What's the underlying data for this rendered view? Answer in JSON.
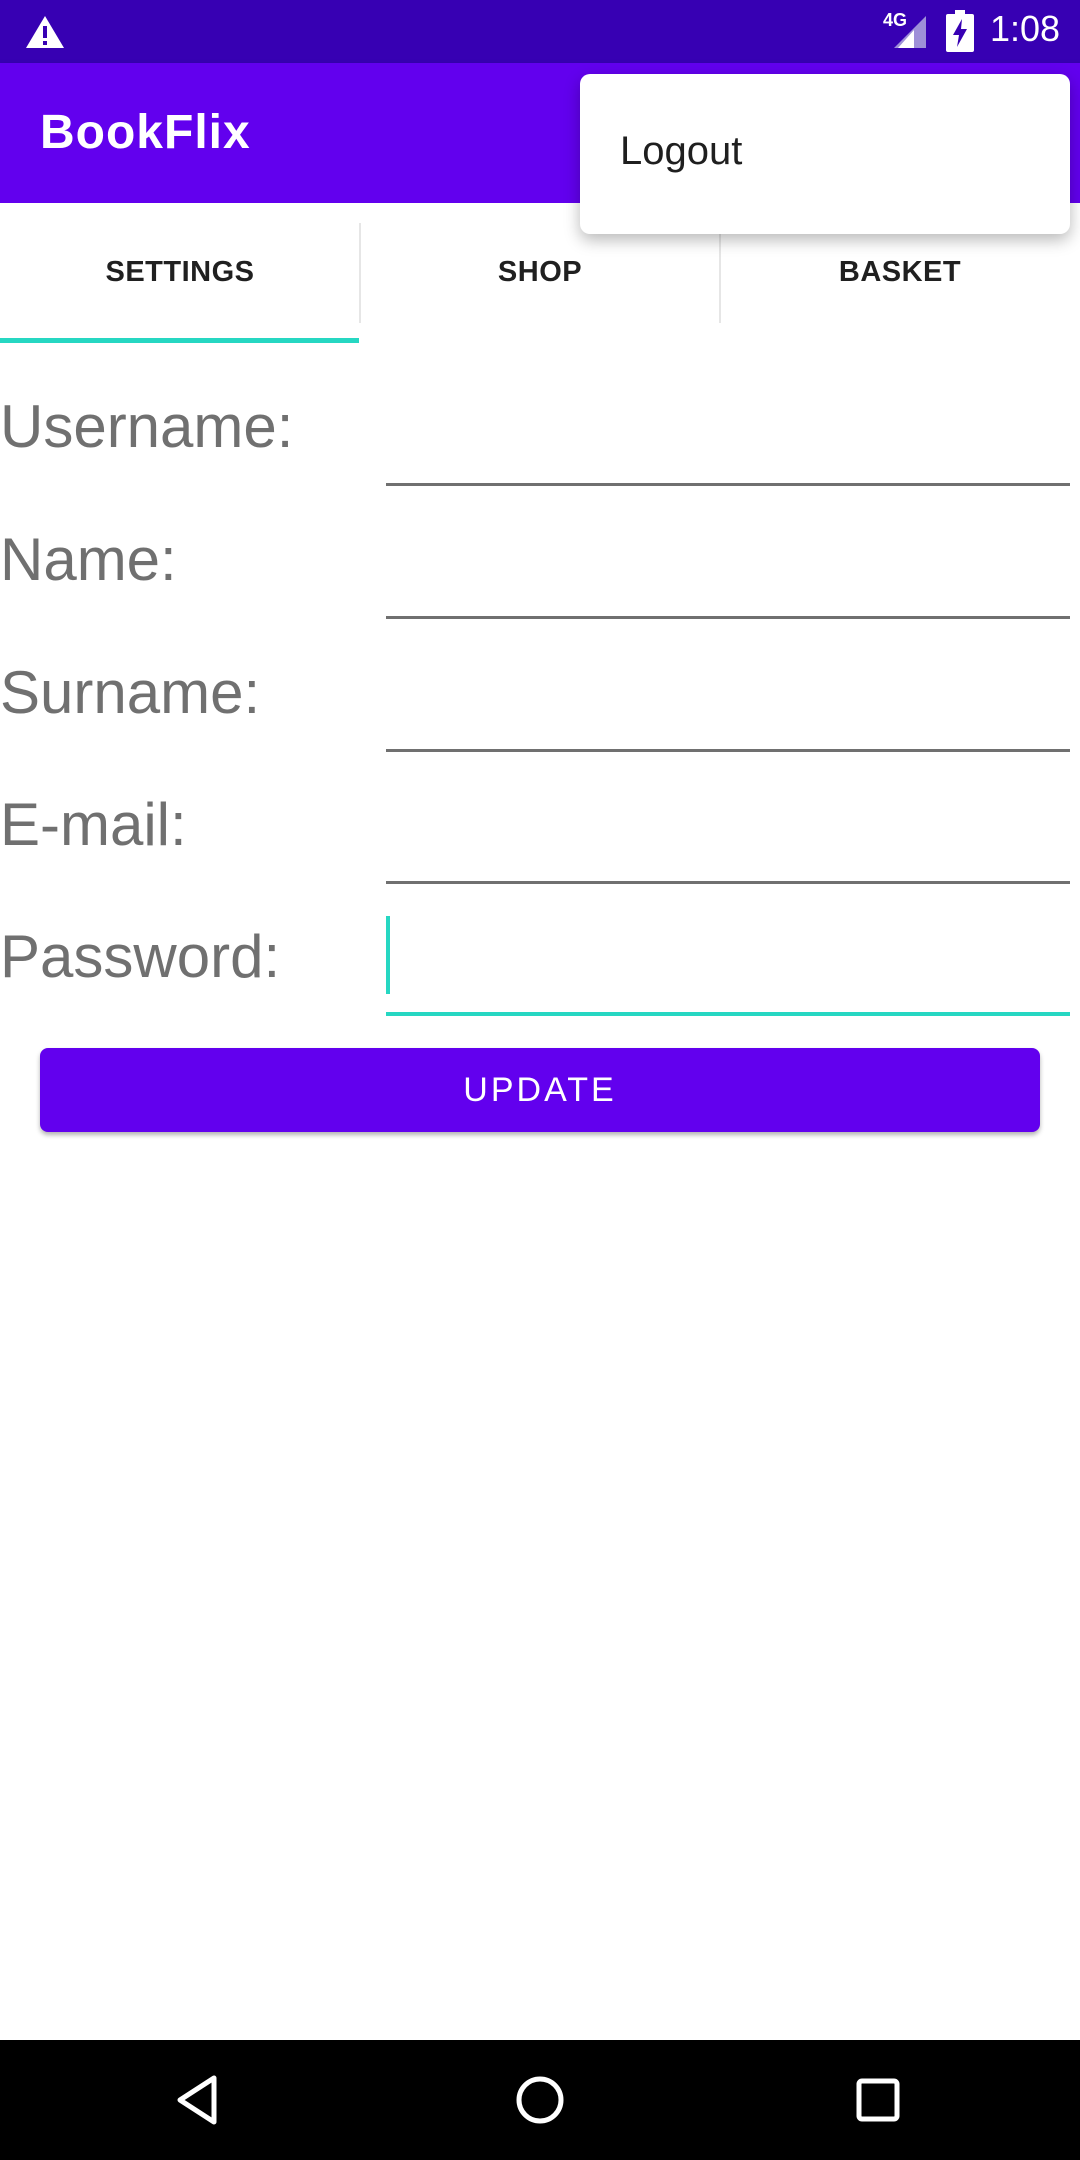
{
  "status_bar": {
    "network": "4G",
    "time": "1:08",
    "icons": [
      "warning-icon",
      "signal-icon",
      "battery-charging-icon"
    ]
  },
  "app_bar": {
    "title": "BookFlix"
  },
  "tabs": [
    {
      "label": "SETTINGS",
      "selected": true
    },
    {
      "label": "SHOP",
      "selected": false
    },
    {
      "label": "BASKET",
      "selected": false
    }
  ],
  "form": {
    "fields": [
      {
        "label": "Username:",
        "value": ""
      },
      {
        "label": "Name:",
        "value": ""
      },
      {
        "label": "Surname:",
        "value": ""
      },
      {
        "label": "E-mail:",
        "value": ""
      },
      {
        "label": "Password:",
        "value": ""
      }
    ],
    "update_label": "UPDATE"
  },
  "menu": {
    "items": [
      {
        "label": "Logout"
      }
    ]
  },
  "nav_bar": {
    "icons": [
      "back-icon",
      "home-icon",
      "recent-apps-icon"
    ]
  },
  "colors": {
    "status_bar": "#3700b3",
    "primary": "#6200ee",
    "accent": "#26d7c2",
    "label_text": "#707070"
  }
}
